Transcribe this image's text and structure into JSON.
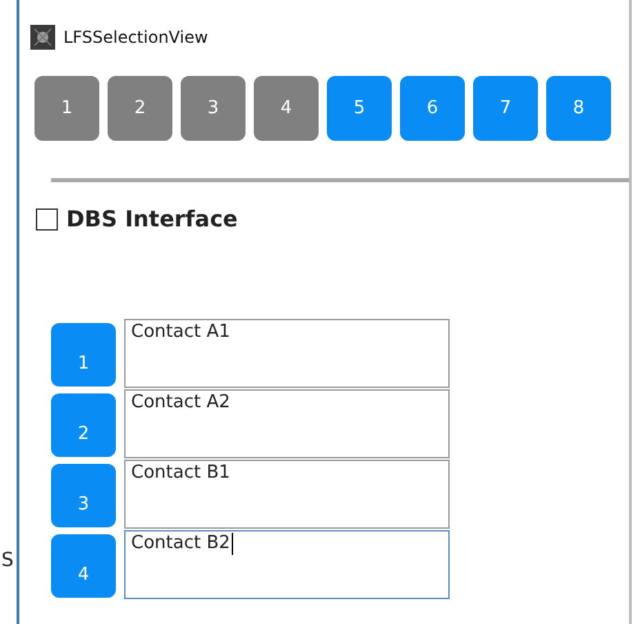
{
  "background_fragment": "S",
  "window": {
    "title": "LFSSelectionView"
  },
  "top_buttons": [
    {
      "label": "1",
      "selected": false
    },
    {
      "label": "2",
      "selected": false
    },
    {
      "label": "3",
      "selected": false
    },
    {
      "label": "4",
      "selected": false
    },
    {
      "label": "5",
      "selected": true
    },
    {
      "label": "6",
      "selected": true
    },
    {
      "label": "7",
      "selected": true
    },
    {
      "label": "8",
      "selected": true
    }
  ],
  "checkbox": {
    "label": "DBS Interface",
    "checked": false
  },
  "contacts": [
    {
      "button": "1",
      "value": "Contact A1",
      "focused": false
    },
    {
      "button": "2",
      "value": "Contact A2",
      "focused": false
    },
    {
      "button": "3",
      "value": "Contact B1",
      "focused": false
    },
    {
      "button": "4",
      "value": "Contact B2",
      "focused": true
    }
  ]
}
